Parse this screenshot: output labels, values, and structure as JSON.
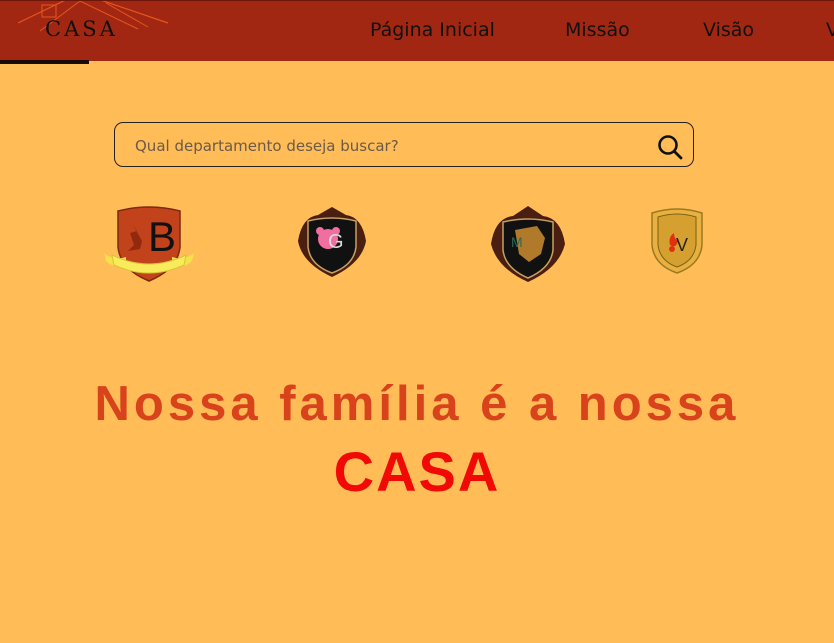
{
  "header": {
    "logo_text": "CASA",
    "nav": [
      {
        "label": "Página Inicial"
      },
      {
        "label": "Missão"
      },
      {
        "label": "Visão"
      },
      {
        "label": "V"
      }
    ]
  },
  "search": {
    "placeholder": "Qual departamento deseja buscar?"
  },
  "crests": [
    {
      "letter": "B",
      "name": "department-crest-b"
    },
    {
      "letter": "G",
      "name": "department-crest-g"
    },
    {
      "letter": "M",
      "name": "department-crest-m"
    },
    {
      "letter": "V",
      "name": "department-crest-v"
    }
  ],
  "hero": {
    "line1": "Nossa família é a nossa",
    "line2": "CASA"
  },
  "colors": {
    "background": "#FFBC57",
    "header": "#A12712",
    "headline": "#D9431C",
    "headline_accent": "#F10A05"
  }
}
